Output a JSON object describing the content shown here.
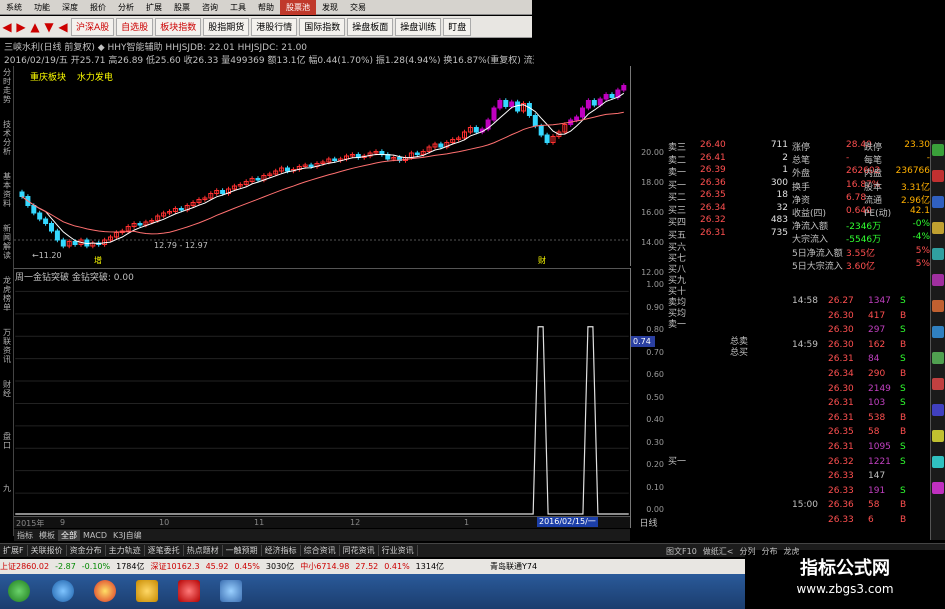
{
  "toolbar": {
    "menus": [
      "系统",
      "功能",
      "深度",
      "报价",
      "分析",
      "扩展",
      "股票",
      "咨询",
      "工具",
      "帮助"
    ],
    "highlight": "股票池",
    "right_items": [
      "发现",
      "交易"
    ]
  },
  "tabbar": {
    "tabs": [
      "沪深A股",
      "自选股",
      "板块指数",
      "股指期货",
      "港股行情",
      "国际指数",
      "操盘板面",
      "操盘训练",
      "盯盘"
    ]
  },
  "chart": {
    "title": "三峡水利(日线 前复权)  ◆ HHY智能辅助  HHJSJDB: 22.01  HHJSJDC: 21.00",
    "info": "2016/02/19/五 开25.71 高26.89 低25.60 收26.33 量499369 额13.1亿 幅0.44(1.70%) 振1.28(4.94%) 换16.87%(重复权) 流通2.96亿 水力发电",
    "sector1": "重庆板块",
    "sector2": "水力发电",
    "low_label": "11.20",
    "range_label": "12.79 - 12.97",
    "y_ticks": [
      "20.00",
      "18.00",
      "16.00",
      "14.00",
      "12.00"
    ],
    "sub_title": "周一金钻突破 金钻突破: 0.00",
    "sub_value": "0.74",
    "sub_y_ticks": [
      "1.00",
      "0.90",
      "0.80",
      "0.70",
      "0.60",
      "0.50",
      "0.40",
      "0.30",
      "0.20",
      "0.10",
      "0.00"
    ],
    "date_ticks": [
      "2015年",
      "9",
      "10",
      "11",
      "12",
      "1"
    ],
    "date_selected": "2016/02/15/一",
    "day_label": "日线",
    "bottom_tabs": [
      "指标",
      "模板",
      "全部",
      "MACD",
      "K3J自编"
    ],
    "marker_a": "财",
    "marker_b": "增"
  },
  "left_rail": [
    "分时走势",
    "技术分析",
    "基本资料",
    "新闻解读",
    "龙虎榜单",
    "万联资讯",
    "财经",
    "盘口",
    "九"
  ],
  "order_book": {
    "sells": [
      {
        "label": "卖三",
        "price": "26.40",
        "vol": "711"
      },
      {
        "label": "卖二",
        "price": "26.41",
        "vol": "2"
      },
      {
        "label": "卖一",
        "price": "26.39",
        "vol": "1"
      }
    ],
    "buys": [
      {
        "label": "买一",
        "price": "26.36",
        "vol": "300"
      },
      {
        "label": "买二",
        "price": "26.35",
        "vol": "18"
      },
      {
        "label": "买三",
        "price": "26.34",
        "vol": "32"
      },
      {
        "label": "买四",
        "price": "26.32",
        "vol": "483"
      },
      {
        "label": "买五",
        "price": "26.31",
        "vol": "735"
      }
    ],
    "extra_labels": [
      "买六",
      "买七",
      "买八",
      "买九",
      "买十",
      "卖均",
      "买均",
      "卖一"
    ],
    "mid_labels": [
      "总卖",
      "总买"
    ],
    "lower_label": "买一"
  },
  "stats": [
    {
      "l1": "涨停",
      "v1": "28.40",
      "l2": "跌停",
      "v2": "23.30"
    },
    {
      "l1": "总笔",
      "v1": "-",
      "l2": "每笔",
      "v2": "-"
    },
    {
      "l1": "外盘",
      "v1": "262602",
      "l2": "内盘",
      "v2": "236766"
    },
    {
      "l1": "换手",
      "v1": "16.87%",
      "l2": "股本",
      "v2": "3.31亿"
    },
    {
      "l1": "净资",
      "v1": "6.78",
      "l2": "流通",
      "v2": "2.96亿"
    },
    {
      "l1": "收益(四)",
      "v1": "0.640",
      "l2": "PE(动)",
      "v2": "42.1"
    },
    {
      "l1": "净流入额",
      "v1": "-2346万",
      "l2": "",
      "v2": "-0%"
    },
    {
      "l1": "大宗流入",
      "v1": "-5546万",
      "l2": "",
      "v2": "-4%"
    },
    {
      "l1": "5日净流入额",
      "v1": "3.55亿",
      "l2": "",
      "v2": "5%"
    },
    {
      "l1": "5日大宗流入",
      "v1": "3.60亿",
      "l2": "",
      "v2": "5%"
    }
  ],
  "ticks": [
    {
      "t": "14:58",
      "p": "26.27",
      "v": "1347",
      "bs": "S"
    },
    {
      "t": "",
      "p": "26.30",
      "v": "417",
      "bs": "B"
    },
    {
      "t": "",
      "p": "26.30",
      "v": "297",
      "bs": "S"
    },
    {
      "t": "14:59",
      "p": "26.30",
      "v": "162",
      "bs": "B"
    },
    {
      "t": "",
      "p": "26.31",
      "v": "84",
      "bs": "S"
    },
    {
      "t": "",
      "p": "26.34",
      "v": "290",
      "bs": "B"
    },
    {
      "t": "",
      "p": "26.30",
      "v": "2149",
      "bs": "S"
    },
    {
      "t": "",
      "p": "26.31",
      "v": "103",
      "bs": "S"
    },
    {
      "t": "",
      "p": "26.31",
      "v": "538",
      "bs": "B"
    },
    {
      "t": "",
      "p": "26.35",
      "v": "58",
      "bs": "B"
    },
    {
      "t": "",
      "p": "26.31",
      "v": "1095",
      "bs": "S"
    },
    {
      "t": "",
      "p": "26.32",
      "v": "1221",
      "bs": "S"
    },
    {
      "t": "",
      "p": "26.33",
      "v": "147",
      "bs": ""
    },
    {
      "t": "",
      "p": "26.33",
      "v": "191",
      "bs": "S"
    },
    {
      "t": "15:00",
      "p": "26.36",
      "v": "58",
      "bs": "B"
    },
    {
      "t": "",
      "p": "26.33",
      "v": "6",
      "bs": "B"
    }
  ],
  "func_bar": [
    "扩展F",
    "关联报价",
    "资金分布",
    "主力轨迹",
    "逐笔委托",
    "热点题材",
    "一触预期",
    "经济指标",
    "综合资讯",
    "同花资讯",
    "行业资讯"
  ],
  "func_right": [
    "图文F10",
    "做纸汇<",
    "分列",
    "分布",
    "龙虎"
  ],
  "status": {
    "sh": "上证2860.02",
    "sh_chg": "-2.87",
    "sh_pct": "-0.10%",
    "sh_amt": "1784亿",
    "sz": "深证10162.3",
    "sz_chg": "45.92",
    "sz_pct": "0.45%",
    "sz_amt": "3030亿",
    "zx": "中小6714.98",
    "zx_chg": "27.52",
    "zx_pct": "0.41%",
    "zx_amt": "1314亿",
    "extra": "青岛联通Y74"
  },
  "watermark": {
    "title": "指标公式网",
    "url": "www.zbgs3.com"
  },
  "colors": {
    "up": "#ff3030",
    "down": "#35d8ff",
    "ma": "#ffffff",
    "ma2": "#ff7070",
    "purple": "#c000c0"
  }
}
